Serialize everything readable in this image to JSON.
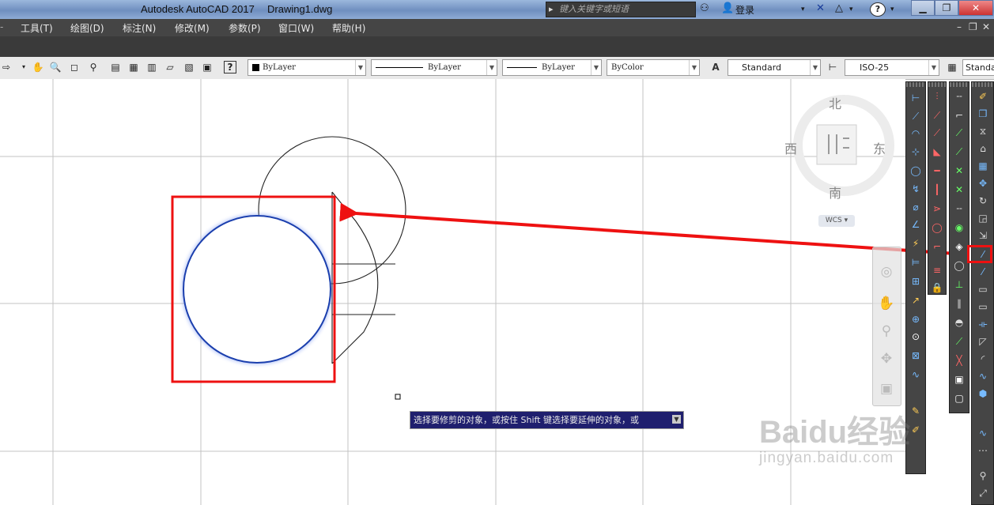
{
  "titlebar": {
    "app": "Autodesk AutoCAD 2017",
    "file": "Drawing1.dwg",
    "search_placeholder": "键入关键字或短语",
    "login": "登录",
    "help": "?"
  },
  "menubar": {
    "items": [
      "工具(T)",
      "绘图(D)",
      "标注(N)",
      "修改(M)",
      "参数(P)",
      "窗口(W)",
      "帮助(H)"
    ]
  },
  "toolbar": {
    "color": "ByLayer",
    "linetype": "ByLayer",
    "lineweight": "ByLayer",
    "plotstyle": "ByColor",
    "text_style": "Standard",
    "dim_style": "ISO-25",
    "table_style": "Standa"
  },
  "viewcube": {
    "north": "北",
    "south": "南",
    "east": "东",
    "west": "西",
    "wcs": "WCS"
  },
  "command_tip": "选择要修剪的对象，或按住 Shift 键选择要延伸的对象，或",
  "watermark": {
    "logo": "Baidu经验",
    "url": "jingyan.baidu.com"
  },
  "colors": {
    "highlight": "#e11111",
    "selection": "#1b3fae",
    "menubar": "#454545",
    "tooltip_bg": "#1f1f6e"
  }
}
